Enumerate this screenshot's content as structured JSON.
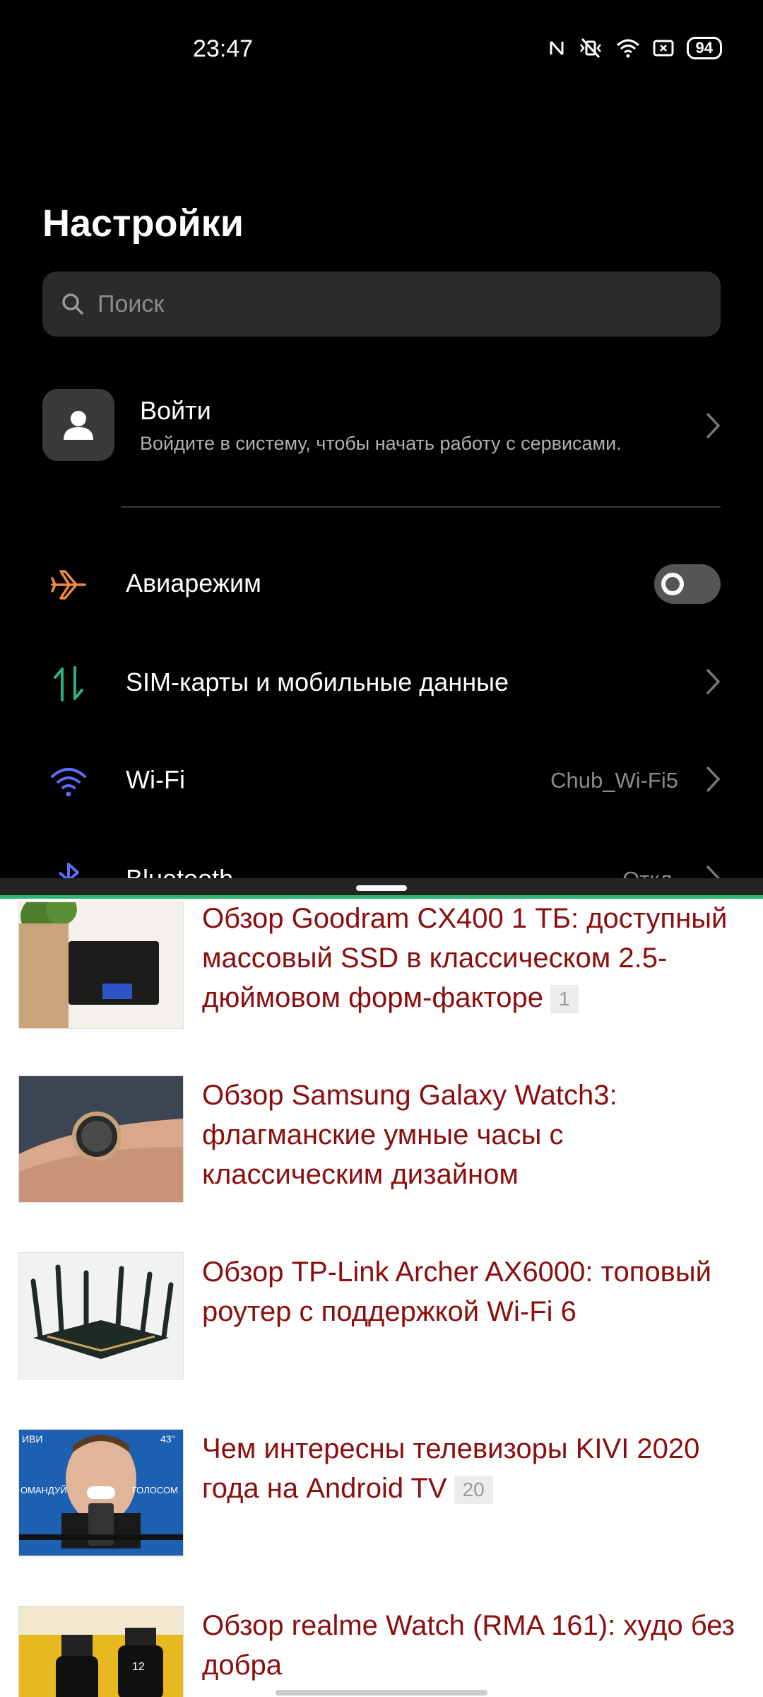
{
  "status_bar": {
    "time": "23:47",
    "battery": "94"
  },
  "settings": {
    "title": "Настройки",
    "search_placeholder": "Поиск",
    "account": {
      "title": "Войти",
      "subtitle": "Войдите в систему, чтобы начать работу с сервисами."
    },
    "rows": [
      {
        "label": "Авиарежим",
        "icon": "airplane-icon"
      },
      {
        "label": "SIM-карты и мобильные данные",
        "icon": "data-arrows-icon"
      },
      {
        "label": "Wi-Fi",
        "value": "Chub_Wi-Fi5",
        "icon": "wifi-icon"
      },
      {
        "label": "Bluetooth",
        "value": "Откл.",
        "icon": "bluetooth-icon"
      }
    ],
    "colors": {
      "airplane": "#f08a3c",
      "sim": "#2bb08a",
      "wifi": "#5b6cf5",
      "bluetooth": "#5b6cf5"
    }
  },
  "articles": [
    {
      "title": "Обзор Goodram CX400 1 ТБ: доступный массовый SSD в классическом 2.5-дюймовом форм-факторе",
      "comments": "1"
    },
    {
      "title": "Обзор Samsung Galaxy Watch3: флагманские умные часы с классическим дизайном"
    },
    {
      "title": "Обзор TP-Link Archer AX6000: топовый роутер с поддержкой Wi-Fi 6"
    },
    {
      "title": "Чем интересны телевизоры KIVI 2020 года на Android TV",
      "comments": "20"
    },
    {
      "title": "Обзор realme Watch (RMA 161): худо без добра"
    }
  ],
  "thumbnails": {
    "t4_tag_left": "ИВИ",
    "t4_tag_right": "43\"",
    "t4_banner_left": "ОМАНДУЙ",
    "t4_banner_right": "ГОЛОСОМ",
    "t5_watch_time": "12"
  }
}
